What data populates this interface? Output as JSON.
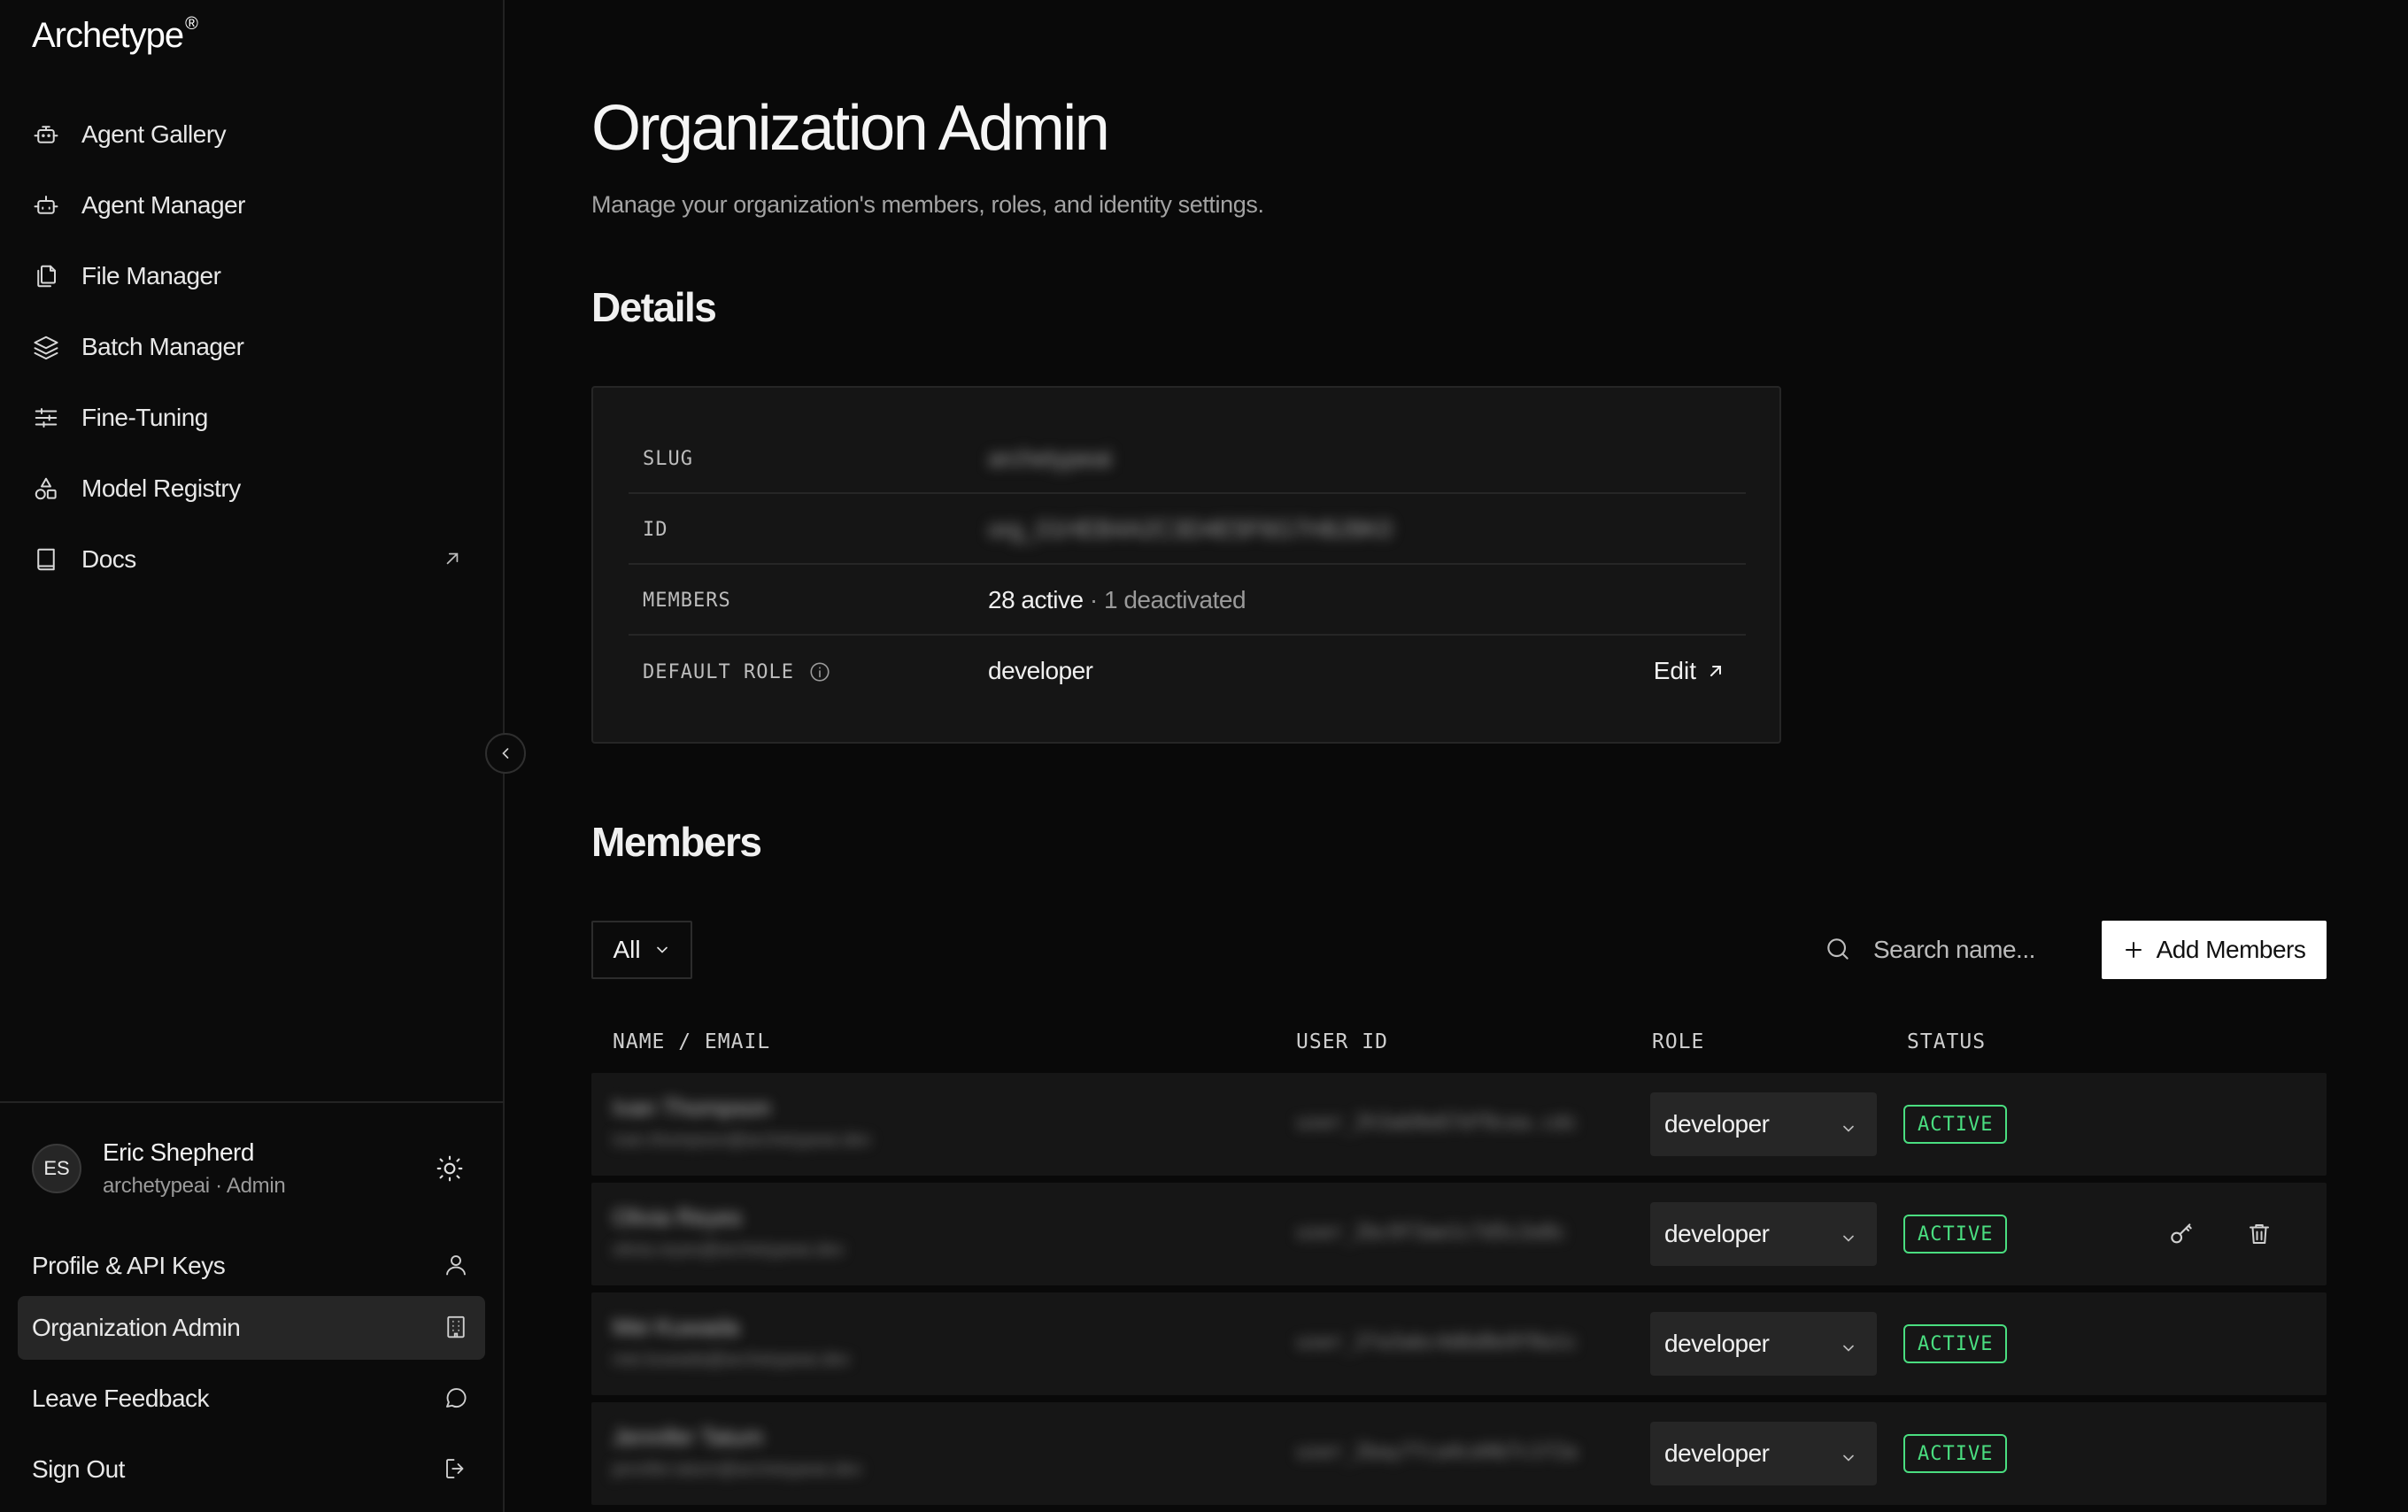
{
  "brand": {
    "name": "Archetype",
    "mark": "®"
  },
  "nav": {
    "items": [
      {
        "label": "Agent Gallery",
        "icon": "robot-icon"
      },
      {
        "label": "Agent Manager",
        "icon": "robot-icon"
      },
      {
        "label": "File Manager",
        "icon": "files-icon"
      },
      {
        "label": "Batch Manager",
        "icon": "layers-icon"
      },
      {
        "label": "Fine-Tuning",
        "icon": "sliders-icon"
      },
      {
        "label": "Model Registry",
        "icon": "shapes-icon"
      },
      {
        "label": "Docs",
        "icon": "book-icon",
        "external": true
      }
    ]
  },
  "user": {
    "initials": "ES",
    "name": "Eric Shepherd",
    "subtitle": "archetypeai · Admin"
  },
  "bottom_nav": {
    "profile": "Profile & API Keys",
    "org_admin": "Organization Admin",
    "feedback": "Leave Feedback",
    "sign_out": "Sign Out"
  },
  "page": {
    "title": "Organization Admin",
    "subtitle": "Manage your organization's members, roles, and identity settings."
  },
  "details": {
    "heading": "Details",
    "slug_key": "SLUG",
    "slug_value": "archetypeai",
    "id_key": "ID",
    "id_value": "org_01HEB4A2C3D4E5F6G7H8J9K0",
    "members_key": "MEMBERS",
    "members_active": "28 active",
    "members_deactivated": " · 1 deactivated",
    "default_role_key": "DEFAULT ROLE",
    "default_role_value": "developer",
    "edit_label": "Edit"
  },
  "members": {
    "heading": "Members",
    "filter_value": "All",
    "search_placeholder": "Search name...",
    "add_label": "Add Members",
    "columns": {
      "name": "NAME / EMAIL",
      "user_id": "USER ID",
      "role": "ROLE",
      "status": "STATUS"
    },
    "rows": [
      {
        "name": "Ivan Thompson",
        "email": "ivan.thompson@archetypeai.dev",
        "user_id": "user_2h3ab9e67df9cea.cdc",
        "role": "developer",
        "status": "ACTIVE"
      },
      {
        "name": "Olivia Reyes",
        "email": "olivia.reyes@archetypeai.dev",
        "user_id": "user_2bc9f3ae1c7d5c2e8c",
        "role": "developer",
        "status": "ACTIVE"
      },
      {
        "name": "Mei Kuwada",
        "email": "mei.kuwada@archetypeai.dev",
        "user_id": "user_2fa3abc4d6d8e9f0a1c",
        "role": "developer",
        "status": "ACTIVE"
      },
      {
        "name": "Jennifer Tatum",
        "email": "jennifer.tatum@archetypeai.dev",
        "user_id": "user_2bay7fca4cd4b7c1f2a",
        "role": "developer",
        "status": "ACTIVE"
      }
    ]
  },
  "colors": {
    "accent_status": "#4ade80",
    "background": "#090909",
    "card": "#151515"
  }
}
